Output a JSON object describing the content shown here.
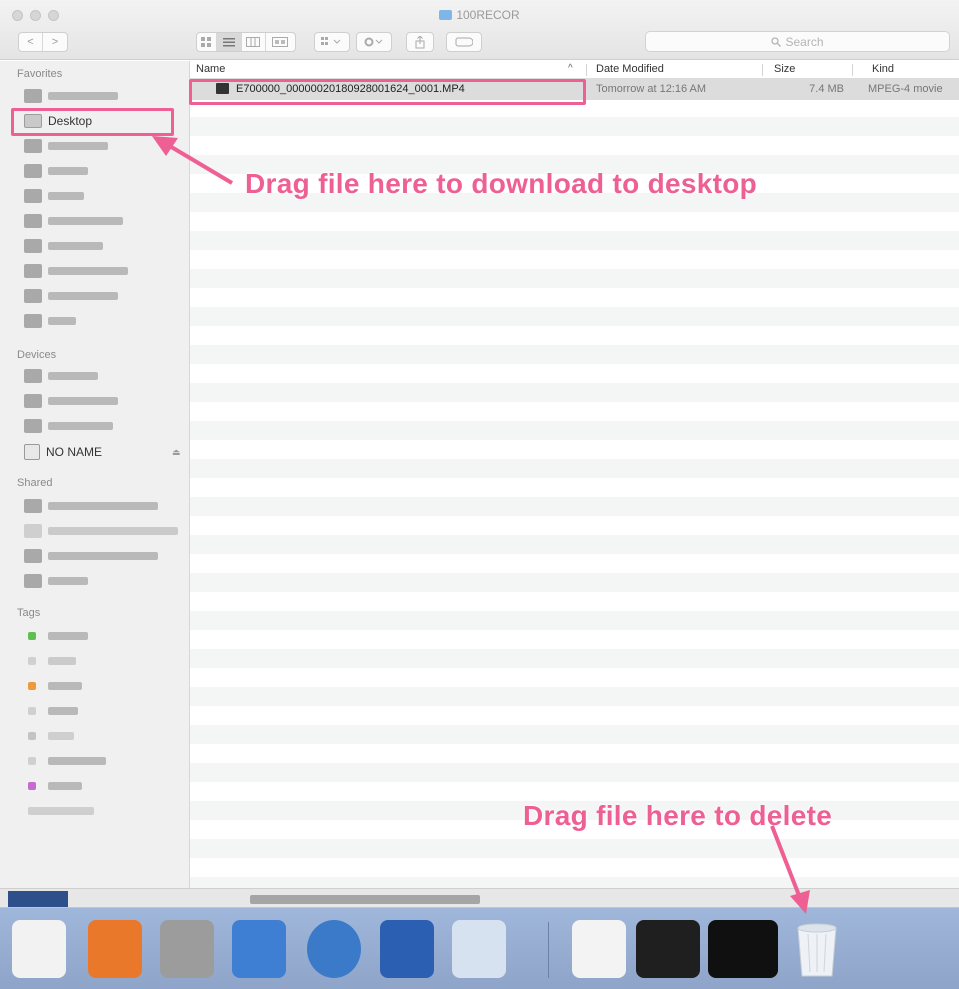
{
  "window": {
    "title": "100RECOR",
    "search_placeholder": "Search",
    "nav": {
      "back": "<",
      "forward": ">"
    }
  },
  "sidebar": {
    "favorites_label": "Favorites",
    "desktop_label": "Desktop",
    "devices_label": "Devices",
    "device_no_name": "NO NAME",
    "shared_label": "Shared",
    "tags_label": "Tags",
    "tag_colors": [
      "#5fbf53",
      "#d0d0d0",
      "#f0993a",
      "#d0d0d0",
      "#c4c4c4",
      "#d0d0d0",
      "#c46ad0"
    ]
  },
  "list": {
    "columns": {
      "name": "Name",
      "date": "Date Modified",
      "size": "Size",
      "kind": "Kind"
    },
    "sort_indicator": "^",
    "files": [
      {
        "name": "E700000_00000020180928001624_0001.MP4",
        "date": "Tomorrow at 12:16 AM",
        "size": "7.4 MB",
        "kind": "MPEG-4 movie"
      }
    ]
  },
  "annotations": {
    "desktop_callout": "Drag file here to download to desktop",
    "trash_callout": "Drag file here to delete",
    "accent_color": "#ee5f93"
  }
}
